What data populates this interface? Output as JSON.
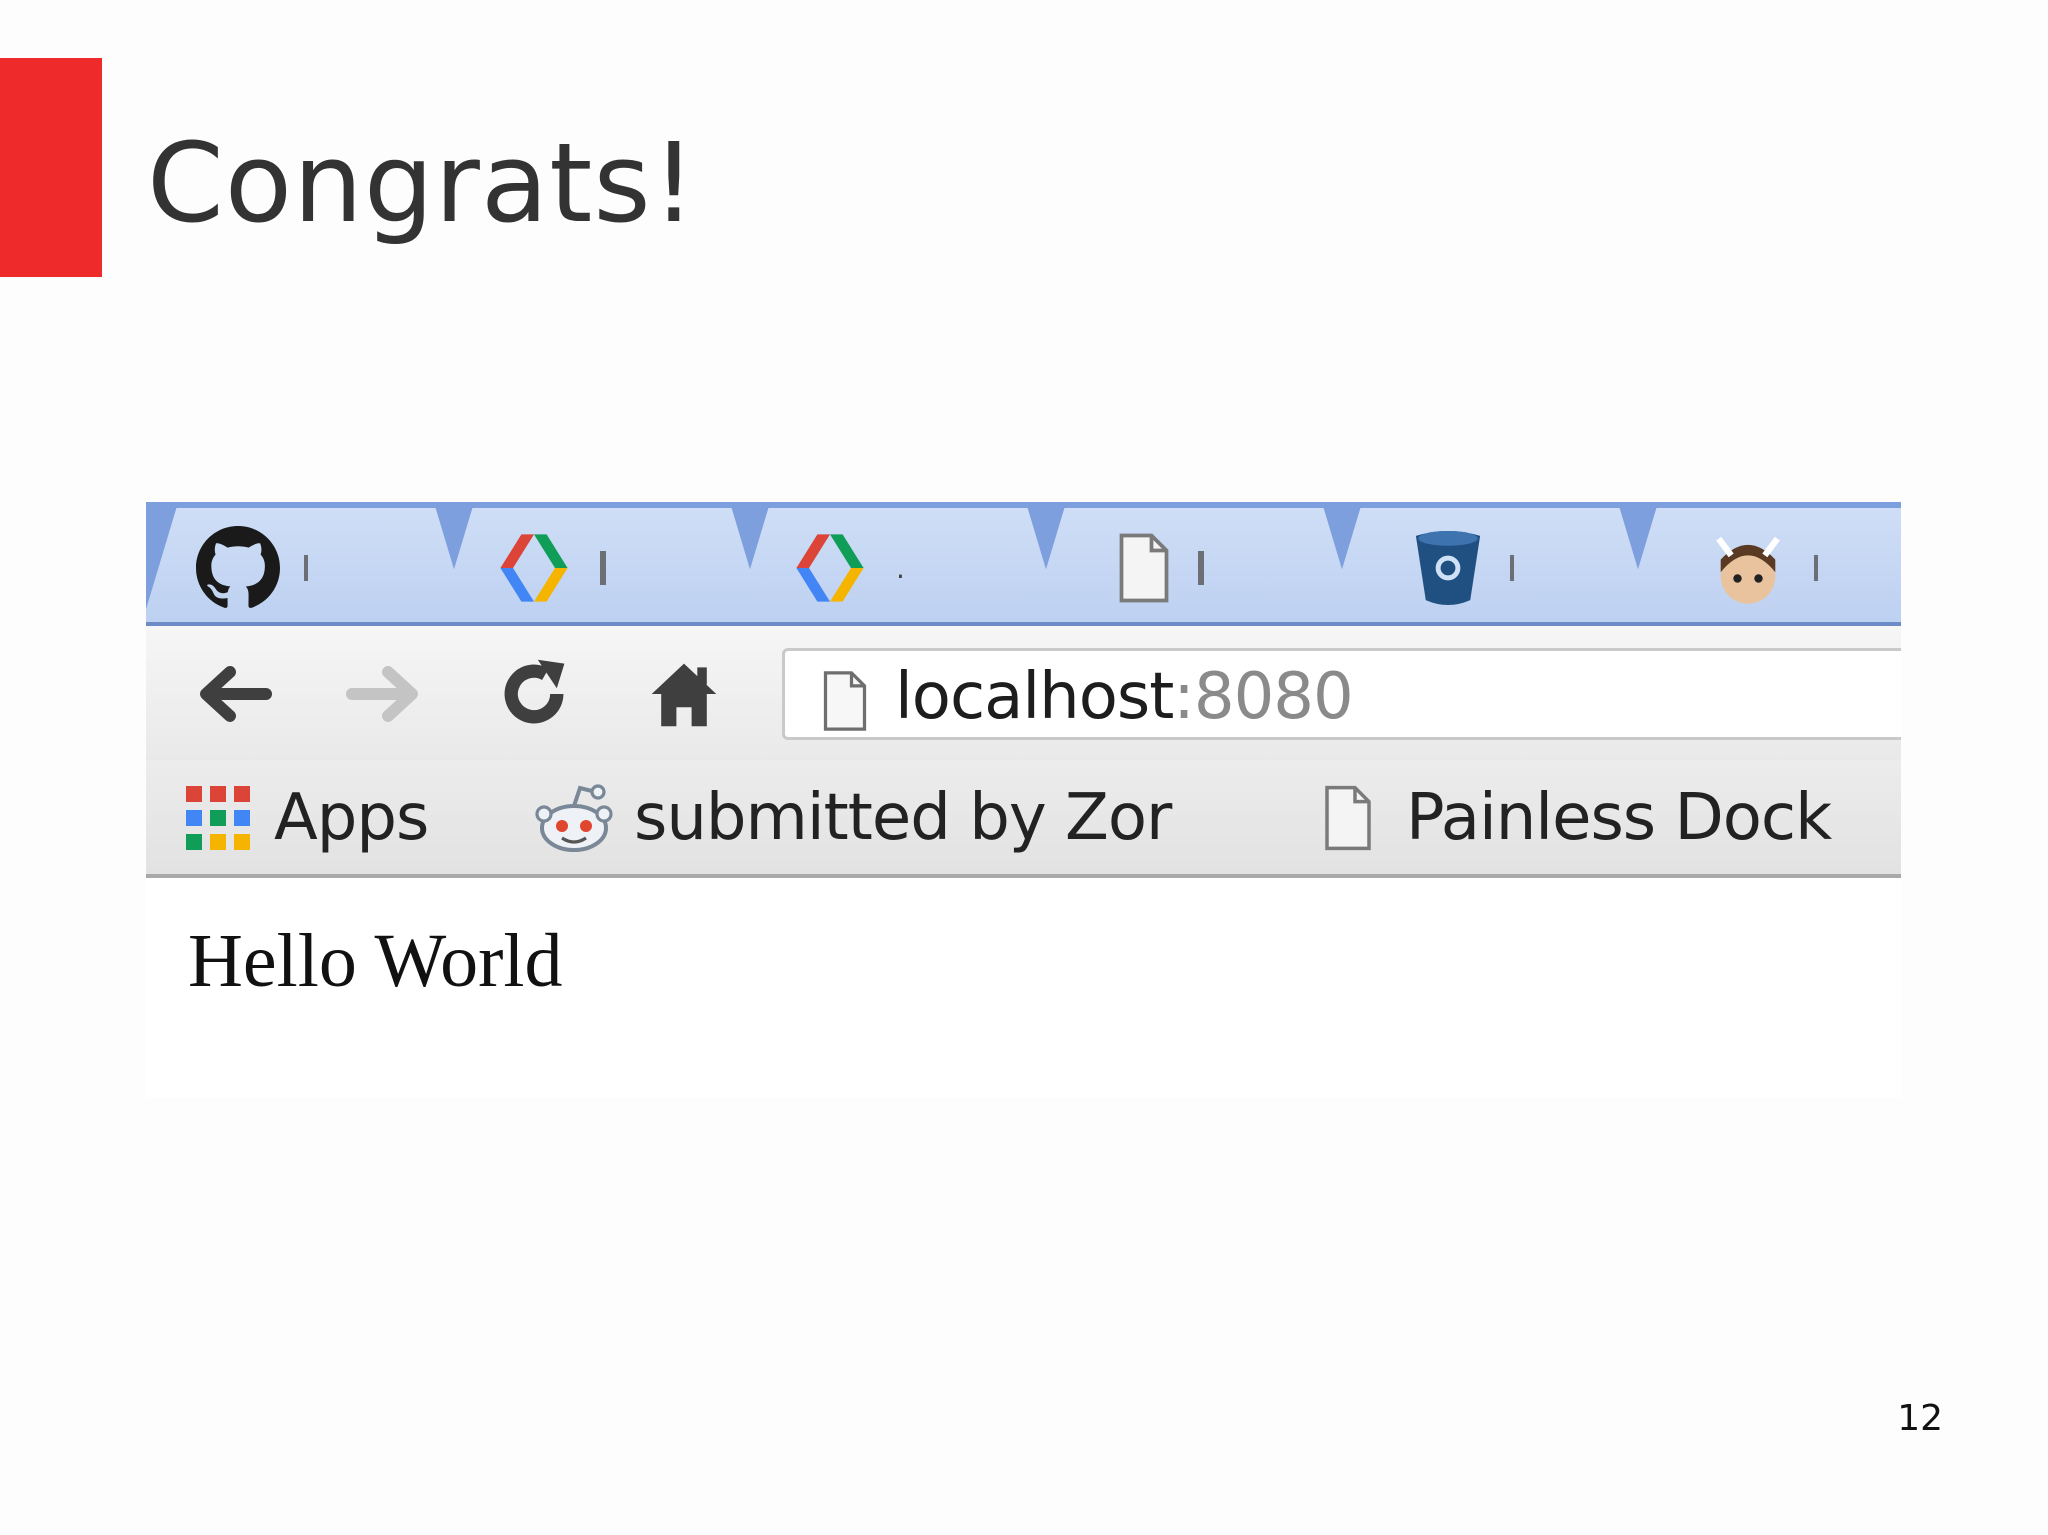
{
  "slide": {
    "title": "Congrats!",
    "page_number": "12",
    "accent_color": "#ee2a2a"
  },
  "browser": {
    "tabs": [
      {
        "icon": "github-icon"
      },
      {
        "icon": "google-developers-icon"
      },
      {
        "icon": "google-developers-icon",
        "title": "."
      },
      {
        "icon": "blank-page-icon"
      },
      {
        "icon": "bitbucket-icon"
      },
      {
        "icon": "avatar-icon"
      }
    ],
    "toolbar": {
      "back": "back-arrow-icon",
      "forward": "forward-arrow-icon",
      "reload": "reload-icon",
      "home": "home-icon"
    },
    "address_bar": {
      "host": "localhost",
      "port": ":8080"
    },
    "bookmarks": [
      {
        "icon": "apps-grid-icon",
        "label": "Apps"
      },
      {
        "icon": "reddit-icon",
        "label": "submitted by Zor"
      },
      {
        "icon": "blank-page-icon",
        "label": "Painless Dock"
      }
    ],
    "page_content": {
      "text": "Hello World"
    }
  }
}
